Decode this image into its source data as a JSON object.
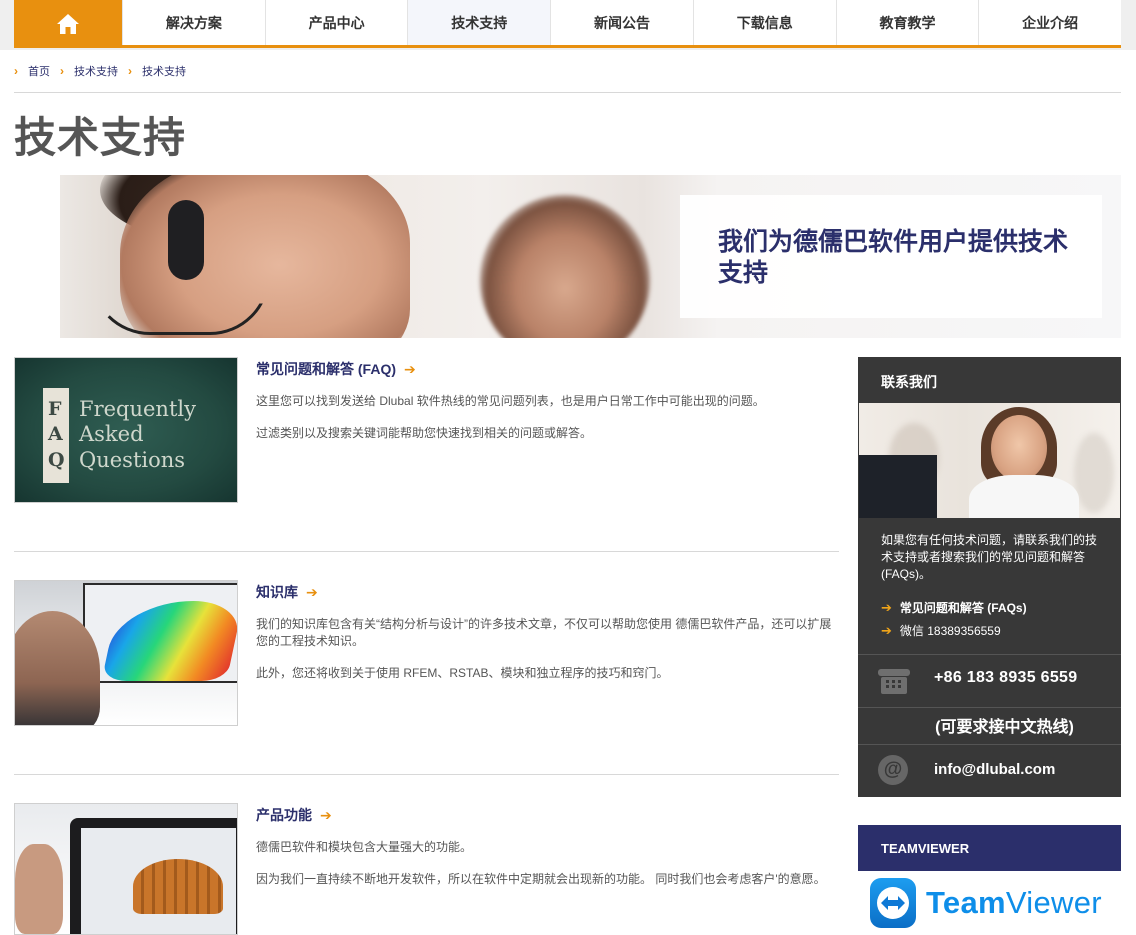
{
  "nav": {
    "home_icon": "house-icon",
    "items": [
      {
        "label": "解决方案"
      },
      {
        "label": "产品中心"
      },
      {
        "label": "技术支持"
      },
      {
        "label": "新闻公告"
      },
      {
        "label": "下载信息"
      },
      {
        "label": "教育教学"
      },
      {
        "label": "企业介绍"
      }
    ],
    "active_index": 2,
    "accent": "#e8900f"
  },
  "breadcrumb": [
    "首页",
    "技术支持",
    "技术支持"
  ],
  "page_title": "技术支持",
  "hero": {
    "headline": "我们为德儒巴软件用户提供技术支持"
  },
  "articles": [
    {
      "title": "常见问题和解答 (FAQ)",
      "thumb_words": [
        "Frequently",
        "Asked",
        "Questions"
      ],
      "thumb_letters": [
        "F",
        "A",
        "Q"
      ],
      "paragraphs": [
        "这里您可以找到发送给 Dlubal 软件热线的常见问题列表，也是用户日常工作中可能出现的问题。",
        "过滤类别以及搜索关键词能帮助您快速找到相关的问题或解答。"
      ]
    },
    {
      "title": "知识库",
      "paragraphs": [
        "我们的知识库包含有关“结构分析与设计”的许多技术文章，不仅可以帮助您使用 德儒巴软件产品，还可以扩展您的工程技术知识。",
        "此外，您还将收到关于使用 RFEM、RSTAB、模块和独立程序的技巧和窍门。"
      ]
    },
    {
      "title": "产品功能",
      "paragraphs": [
        "德儒巴软件和模块包含大量强大的功能。",
        "因为我们一直持续不断地开发软件，所以在软件中定期就会出现新的功能。 同时我们也会考虑客户'的意愿。"
      ]
    }
  ],
  "contact": {
    "heading": "联系我们",
    "text": "如果您有任何技术问题，请联系我们的技术支持或者搜索我们的常见问题和解答 (FAQs)。",
    "links": [
      {
        "label": "常见问题和解答 (FAQs)"
      },
      {
        "label": "微信 18389356559"
      }
    ],
    "phone": "+86 183 8935 6559",
    "hotline_note": "(可要求接中文热线)",
    "email": "info@dlubal.com",
    "bg_color": "#383838",
    "link_arrow_color": "#f0a51a"
  },
  "teamviewer": {
    "heading": "TEAMVIEWER",
    "logo_team": "Team",
    "logo_viewer": "Viewer",
    "bar_color": "#2b2f6b"
  }
}
